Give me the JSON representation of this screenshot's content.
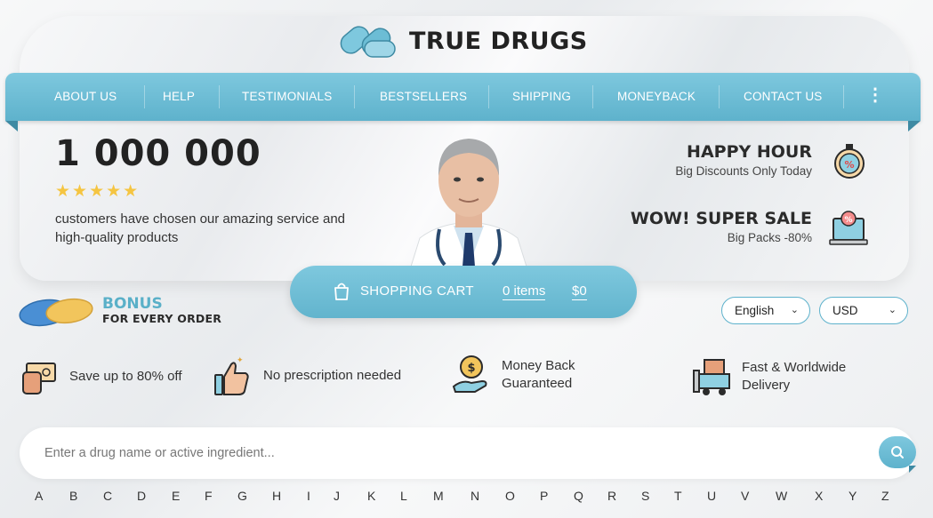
{
  "brand": {
    "name": "TRUE DRUGS"
  },
  "nav": {
    "items": [
      {
        "label": "ABOUT US"
      },
      {
        "label": "HELP"
      },
      {
        "label": "TESTIMONIALS"
      },
      {
        "label": "BESTSELLERS"
      },
      {
        "label": "SHIPPING"
      },
      {
        "label": "MONEYBACK"
      },
      {
        "label": "CONTACT US"
      }
    ],
    "more_icon": "vertical-dots-icon"
  },
  "hero": {
    "customers_count": "1 000 000",
    "rating_stars": "★★★★★",
    "rating_value": 5,
    "description": "customers have chosen our amazing service and high-quality products"
  },
  "promos": [
    {
      "title": "HAPPY HOUR",
      "subtitle": "Big Discounts Only Today",
      "icon": "stopwatch-discount-icon"
    },
    {
      "title": "WOW! SUPER SALE",
      "subtitle": "Big Packs -80%",
      "icon": "laptop-sale-icon"
    }
  ],
  "cart": {
    "label": "SHOPPING CART",
    "items": "0 items",
    "total": "$0",
    "icon": "shopping-bag-icon"
  },
  "bonus": {
    "title": "BONUS",
    "subtitle": "FOR EVERY ORDER"
  },
  "language": {
    "selected": "English"
  },
  "currency": {
    "selected": "USD"
  },
  "features": [
    {
      "text": "Save up to 80% off",
      "icon": "cash-hand-icon"
    },
    {
      "text": "No prescription needed",
      "icon": "thumbs-up-icon"
    },
    {
      "text": "Money Back Guaranteed",
      "icon": "coin-hand-icon"
    },
    {
      "text": "Fast & Worldwide Delivery",
      "icon": "delivery-truck-icon"
    }
  ],
  "search": {
    "placeholder": "Enter a drug name or active ingredient...",
    "value": ""
  },
  "alphabet": [
    "A",
    "B",
    "C",
    "D",
    "E",
    "F",
    "G",
    "H",
    "I",
    "J",
    "K",
    "L",
    "M",
    "N",
    "O",
    "P",
    "Q",
    "R",
    "S",
    "T",
    "U",
    "V",
    "W",
    "X",
    "Y",
    "Z"
  ],
  "colors": {
    "accent": "#6cbdd5",
    "accent_dark": "#3e8aa3",
    "star": "#f5c542",
    "text": "#2b2b2b"
  }
}
